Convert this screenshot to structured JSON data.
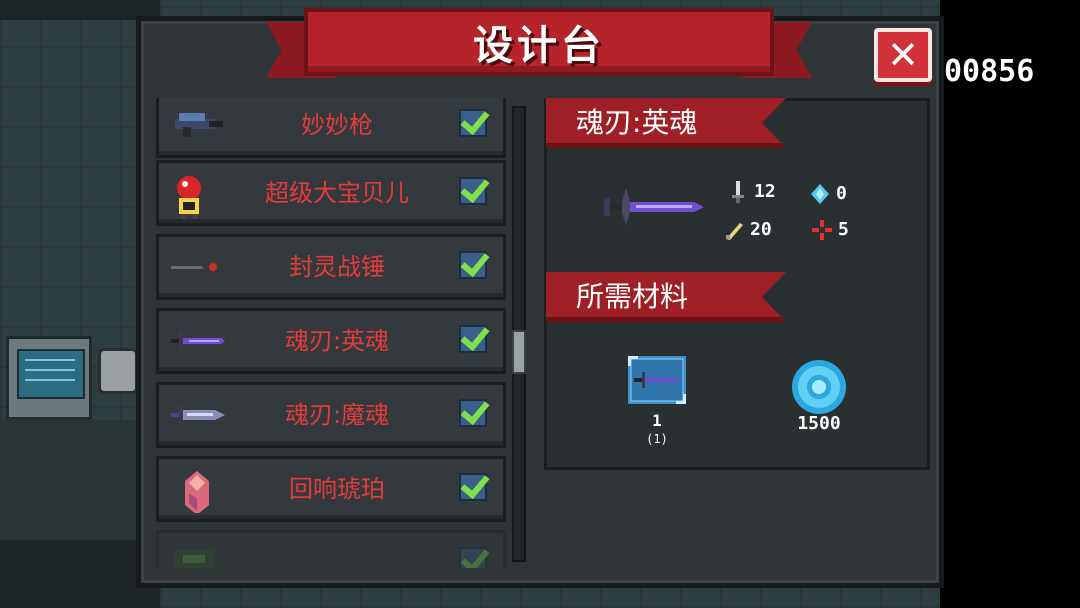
{
  "window": {
    "title": "设计台"
  },
  "hud": {
    "coins": "00856"
  },
  "close_button": {
    "label": "✕"
  },
  "list": {
    "items": [
      {
        "label": "妙妙枪",
        "checked": true,
        "icon": "blaster-gun-icon"
      },
      {
        "label": "超级大宝贝儿",
        "checked": true,
        "icon": "red-baby-bomb-icon"
      },
      {
        "label": "封灵战锤",
        "checked": true,
        "icon": "spiked-hammer-icon"
      },
      {
        "label": "魂刃:英魂",
        "checked": true,
        "icon": "purple-sword-icon"
      },
      {
        "label": "魂刃:魔魂",
        "checked": true,
        "icon": "purple-blade-icon"
      },
      {
        "label": "回响琥珀",
        "checked": true,
        "icon": "amber-gem-icon"
      },
      {
        "label": "",
        "checked": true,
        "icon": "dragon-icon"
      }
    ]
  },
  "detail": {
    "name": "魂刃:英魂",
    "stats": {
      "damage": "12",
      "energy": "0",
      "crit": "20",
      "accuracy": "5"
    },
    "materials_title": "所需材料",
    "materials": [
      {
        "icon": "sword-blueprint-icon",
        "count": "1",
        "sub": "(1)"
      },
      {
        "icon": "blue-gem-icon",
        "count": "1500"
      }
    ]
  },
  "colors": {
    "accent_red": "#b5242b",
    "item_text": "#e33a3a",
    "check_green": "#7fe04a"
  }
}
